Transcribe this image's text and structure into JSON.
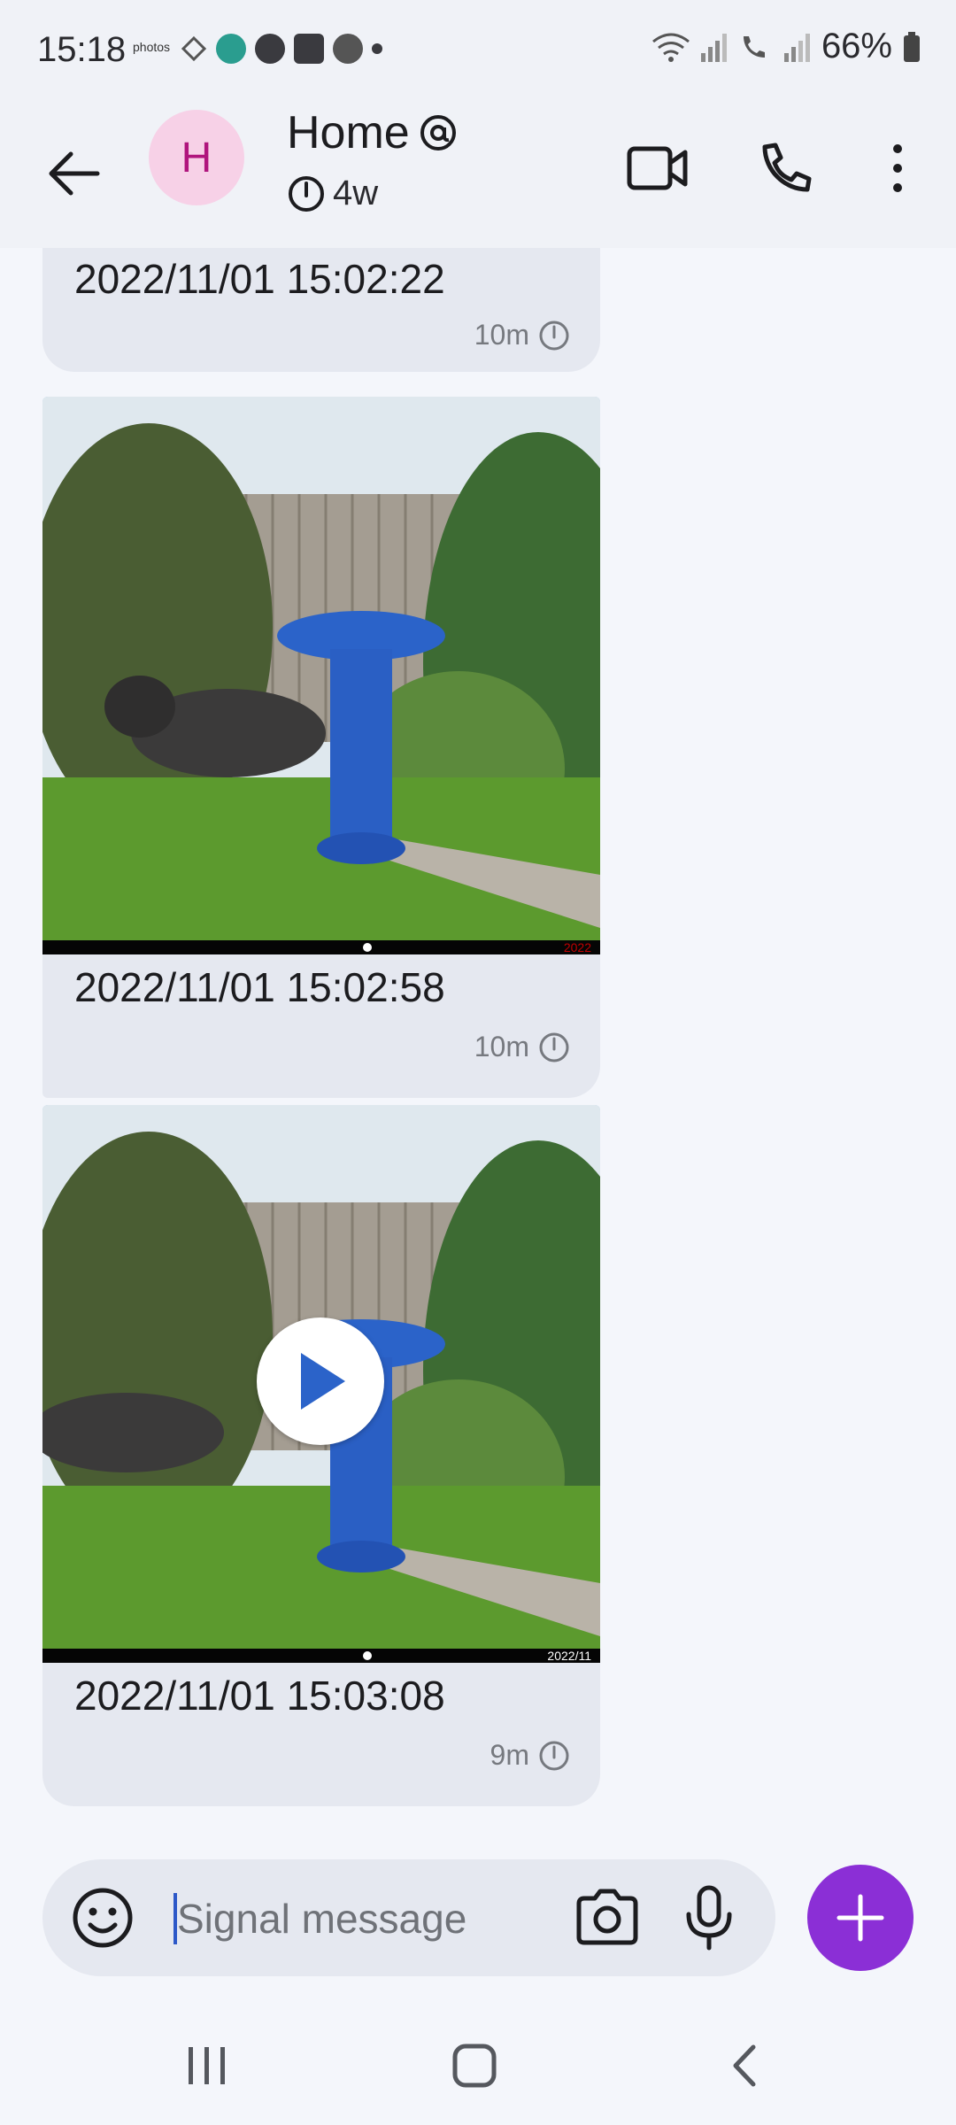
{
  "status_bar": {
    "time": "15:18",
    "notification_icons": [
      "photos-icon",
      "dropbox-icon",
      "app-icon",
      "s-app-icon",
      "book-app-icon",
      "weather-icon",
      "more-dot-icon"
    ],
    "photos_label": "photos",
    "battery": "66%",
    "status_icons": [
      "wifi-icon",
      "signal-icon",
      "wifi-call-icon",
      "signal-icon",
      "battery-icon"
    ]
  },
  "header": {
    "avatar_letter": "H",
    "title": "Home",
    "timer": "4w",
    "colors": {
      "avatar_bg": "#f7d1e7",
      "avatar_fg": "#b0157d"
    }
  },
  "messages": [
    {
      "caption": "2022/11/01 15:02:22",
      "age": "10m",
      "has_media": false
    },
    {
      "caption": "2022/11/01 15:02:58",
      "age": "10m",
      "has_media": true,
      "media_type": "image",
      "media_overlay_text": "2022"
    },
    {
      "caption": "2022/11/01 15:03:08",
      "age": "9m",
      "has_media": true,
      "media_type": "video",
      "media_overlay_text": "2022/11"
    }
  ],
  "composer": {
    "placeholder": "Signal message",
    "accent_color": "#8b2fd6"
  },
  "nav_bar": {
    "buttons": [
      "recents-icon",
      "home-icon",
      "back-icon"
    ]
  }
}
